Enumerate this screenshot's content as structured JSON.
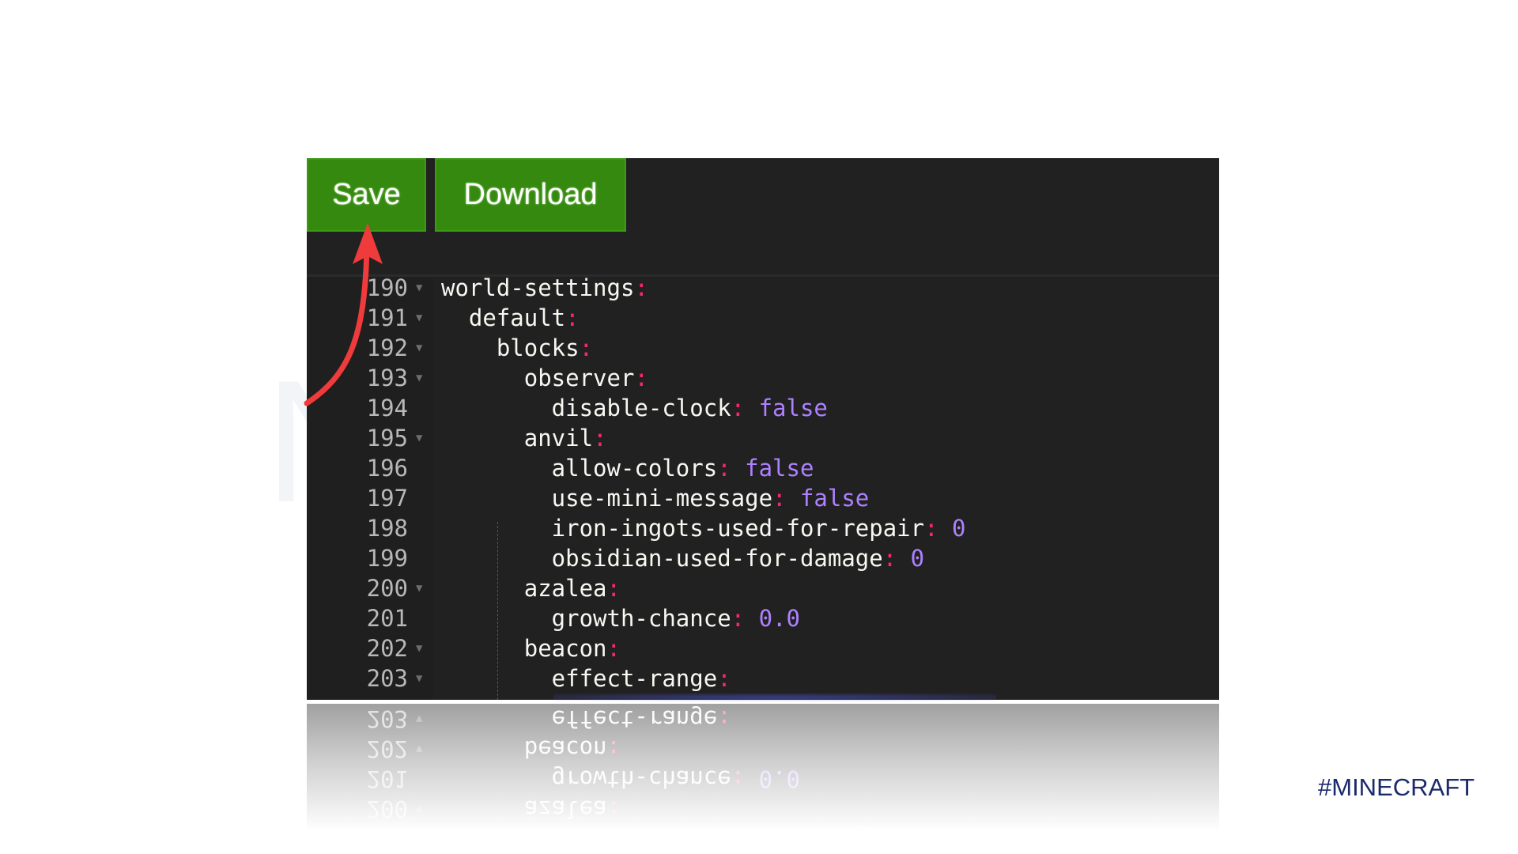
{
  "toolbar": {
    "save_label": "Save",
    "download_label": "Download",
    "button_color": "#35890f"
  },
  "editor": {
    "lines": [
      {
        "n": "190",
        "fold": true,
        "indent": "",
        "key": "world-settings",
        "value": ""
      },
      {
        "n": "191",
        "fold": true,
        "indent": "  ",
        "key": "default",
        "value": ""
      },
      {
        "n": "192",
        "fold": true,
        "indent": "    ",
        "key": "blocks",
        "value": ""
      },
      {
        "n": "193",
        "fold": true,
        "indent": "      ",
        "key": "observer",
        "value": ""
      },
      {
        "n": "194",
        "fold": false,
        "indent": "        ",
        "key": "disable-clock",
        "value": "false"
      },
      {
        "n": "195",
        "fold": true,
        "indent": "      ",
        "key": "anvil",
        "value": ""
      },
      {
        "n": "196",
        "fold": false,
        "indent": "        ",
        "key": "allow-colors",
        "value": "false"
      },
      {
        "n": "197",
        "fold": false,
        "indent": "        ",
        "key": "use-mini-message",
        "value": "false"
      },
      {
        "n": "198",
        "fold": false,
        "indent": "        ",
        "key": "iron-ingots-used-for-repair",
        "value": "0"
      },
      {
        "n": "199",
        "fold": false,
        "indent": "        ",
        "key": "obsidian-used-for-damage",
        "value": "0"
      },
      {
        "n": "200",
        "fold": true,
        "indent": "      ",
        "key": "azalea",
        "value": ""
      },
      {
        "n": "201",
        "fold": false,
        "indent": "        ",
        "key": "growth-chance",
        "value": "0.0"
      },
      {
        "n": "202",
        "fold": true,
        "indent": "      ",
        "key": "beacon",
        "value": ""
      },
      {
        "n": "203",
        "fold": true,
        "indent": "        ",
        "key": "effect-range",
        "value": ""
      }
    ],
    "colors": {
      "key": "#f8f8f2",
      "colon": "#f92672",
      "value": "#ae81ff",
      "background": "#212121"
    }
  },
  "watermark": "NeuronVM",
  "tag": "#MINECRAFT",
  "annotation": {
    "arrow_color": "#ef3b3b",
    "target": "Save"
  }
}
